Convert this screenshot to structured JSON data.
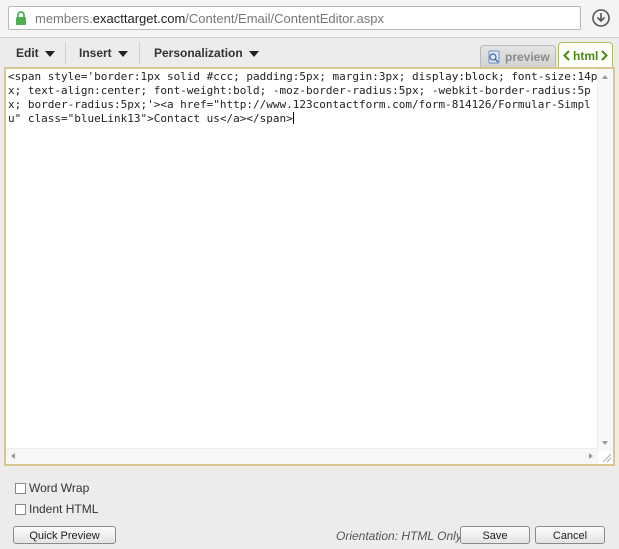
{
  "browser": {
    "url_domain_prefix": "members.",
    "url_domain": "exacttarget.com",
    "url_path": "/Content/Email/ContentEditor.aspx"
  },
  "toolbar": {
    "menus": [
      {
        "label": "Edit"
      },
      {
        "label": "Insert"
      },
      {
        "label": "Personalization"
      }
    ],
    "tabs": {
      "preview_label": "preview",
      "html_label": "html"
    }
  },
  "editor": {
    "content": "<span style='border:1px solid #ccc; padding:5px; margin:3px; display:block; font-size:14px; text-align:center; font-weight:bold; -moz-border-radius:5px; -webkit-border-radius:5px; border-radius:5px;'><a href=\"http://www.123contactform.com/form-814126/Formular-Simplu\" class=\"blueLink13\">Contact us</a></span>"
  },
  "options": {
    "word_wrap_label": "Word Wrap",
    "word_wrap_checked": false,
    "indent_html_label": "Indent HTML",
    "indent_html_checked": false
  },
  "footer": {
    "quick_preview_label": "Quick Preview",
    "orientation_text": "Orientation: HTML Only",
    "save_label": "Save",
    "cancel_label": "Cancel"
  },
  "colors": {
    "editor_border": "#d8c690",
    "html_tab_text": "#4a8a10",
    "lock": "#4caf50"
  }
}
